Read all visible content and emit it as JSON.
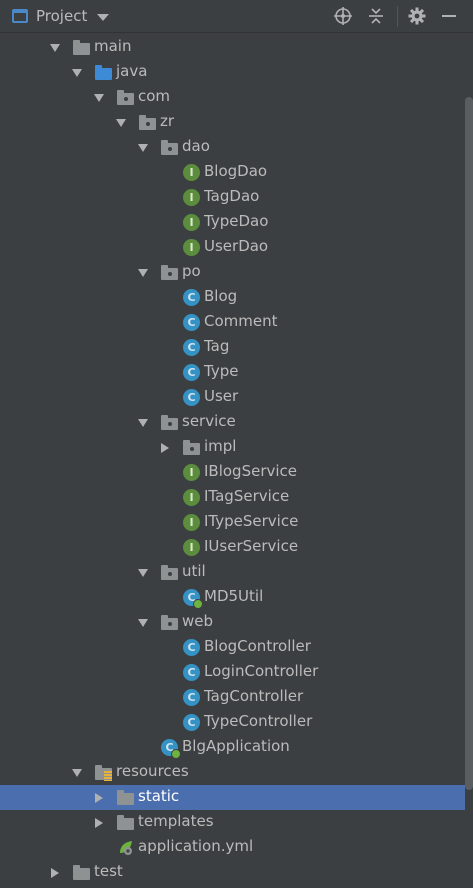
{
  "toolbar": {
    "title": "Project",
    "icons": [
      "window-icon",
      "dropdown-icon",
      "locate-icon",
      "collapse-all-icon",
      "gear-icon",
      "minimize-icon"
    ]
  },
  "tree": [
    {
      "label": "main",
      "depth": 0,
      "arrow": "down",
      "icon": "folder"
    },
    {
      "label": "java",
      "depth": 1,
      "arrow": "down",
      "icon": "folder-blue"
    },
    {
      "label": "com",
      "depth": 2,
      "arrow": "down",
      "icon": "package"
    },
    {
      "label": "zr",
      "depth": 3,
      "arrow": "down",
      "icon": "package"
    },
    {
      "label": "dao",
      "depth": 4,
      "arrow": "down",
      "icon": "package"
    },
    {
      "label": "BlogDao",
      "depth": 5,
      "arrow": "none",
      "icon": "interface"
    },
    {
      "label": "TagDao",
      "depth": 5,
      "arrow": "none",
      "icon": "interface"
    },
    {
      "label": "TypeDao",
      "depth": 5,
      "arrow": "none",
      "icon": "interface"
    },
    {
      "label": "UserDao",
      "depth": 5,
      "arrow": "none",
      "icon": "interface"
    },
    {
      "label": "po",
      "depth": 4,
      "arrow": "down",
      "icon": "package"
    },
    {
      "label": "Blog",
      "depth": 5,
      "arrow": "none",
      "icon": "class"
    },
    {
      "label": "Comment",
      "depth": 5,
      "arrow": "none",
      "icon": "class"
    },
    {
      "label": "Tag",
      "depth": 5,
      "arrow": "none",
      "icon": "class"
    },
    {
      "label": "Type",
      "depth": 5,
      "arrow": "none",
      "icon": "class"
    },
    {
      "label": "User",
      "depth": 5,
      "arrow": "none",
      "icon": "class"
    },
    {
      "label": "service",
      "depth": 4,
      "arrow": "down",
      "icon": "package"
    },
    {
      "label": "impl",
      "depth": 5,
      "arrow": "right",
      "icon": "package"
    },
    {
      "label": "IBlogService",
      "depth": 5,
      "arrow": "none",
      "icon": "interface"
    },
    {
      "label": "ITagService",
      "depth": 5,
      "arrow": "none",
      "icon": "interface"
    },
    {
      "label": "ITypeService",
      "depth": 5,
      "arrow": "none",
      "icon": "interface"
    },
    {
      "label": "IUserService",
      "depth": 5,
      "arrow": "none",
      "icon": "interface"
    },
    {
      "label": "util",
      "depth": 4,
      "arrow": "down",
      "icon": "package"
    },
    {
      "label": "MD5Util",
      "depth": 5,
      "arrow": "none",
      "icon": "class-spring"
    },
    {
      "label": "web",
      "depth": 4,
      "arrow": "down",
      "icon": "package"
    },
    {
      "label": "BlogController",
      "depth": 5,
      "arrow": "none",
      "icon": "class"
    },
    {
      "label": "LoginController",
      "depth": 5,
      "arrow": "none",
      "icon": "class"
    },
    {
      "label": "TagController",
      "depth": 5,
      "arrow": "none",
      "icon": "class"
    },
    {
      "label": "TypeController",
      "depth": 5,
      "arrow": "none",
      "icon": "class"
    },
    {
      "label": "BlgApplication",
      "depth": 4,
      "arrow": "none",
      "icon": "spring-app"
    },
    {
      "label": "resources",
      "depth": 1,
      "arrow": "down",
      "icon": "folder-resources"
    },
    {
      "label": "static",
      "depth": 2,
      "arrow": "right",
      "icon": "folder",
      "selected": true
    },
    {
      "label": "templates",
      "depth": 2,
      "arrow": "right",
      "icon": "folder"
    },
    {
      "label": "application.yml",
      "depth": 2,
      "arrow": "none",
      "icon": "spring-config"
    },
    {
      "label": "test",
      "depth": 0,
      "arrow": "right",
      "icon": "folder"
    }
  ]
}
